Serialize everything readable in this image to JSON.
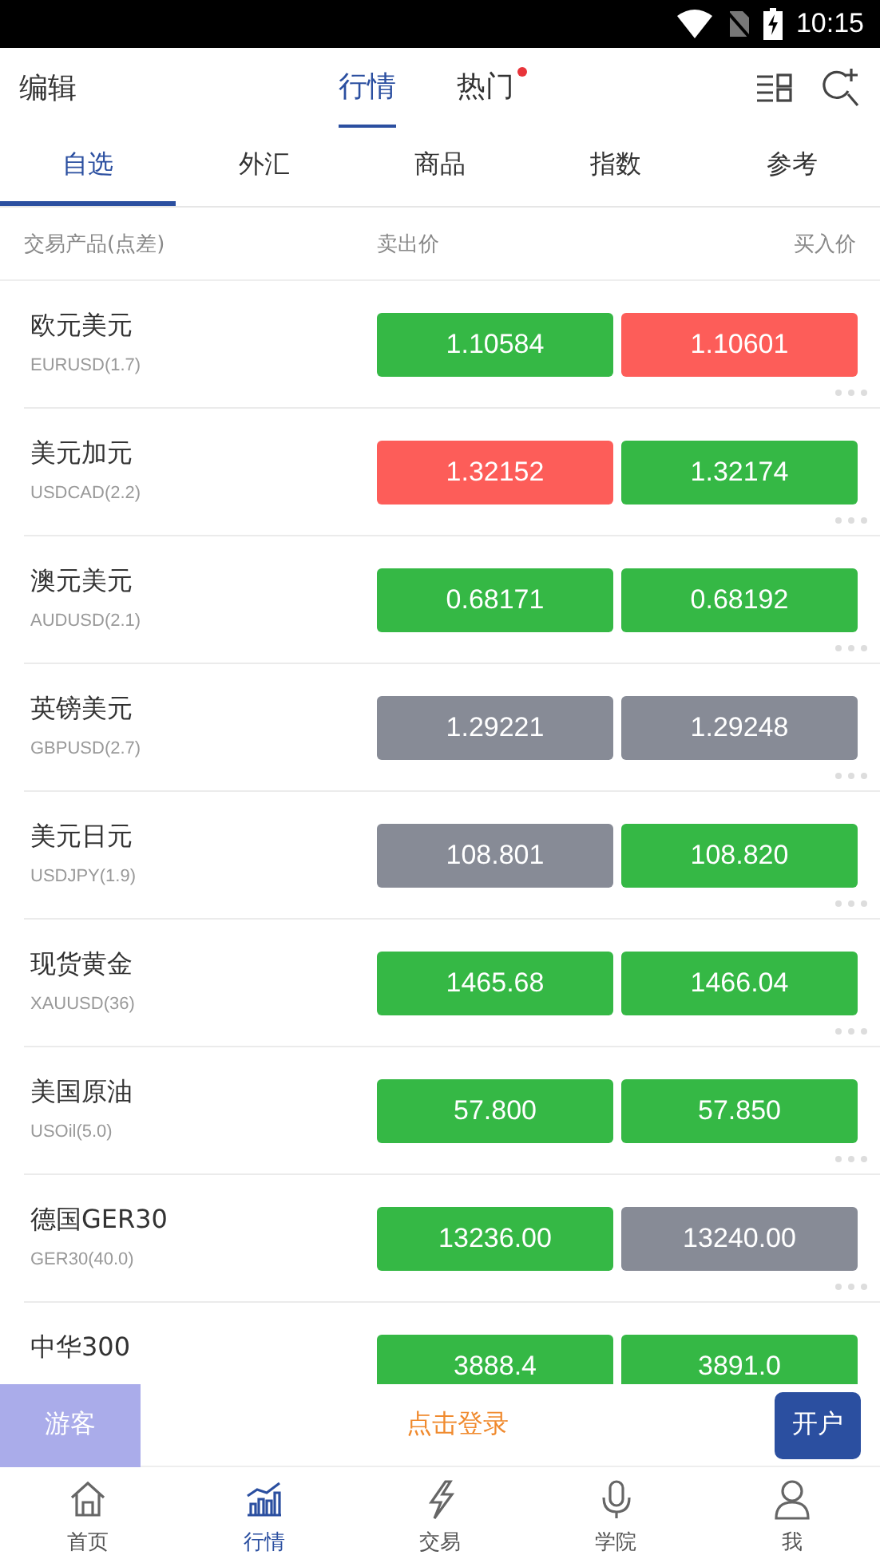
{
  "status_bar": {
    "time": "10:15"
  },
  "header": {
    "edit": "编辑",
    "tabs": [
      {
        "label": "行情",
        "selected": true,
        "dot": false
      },
      {
        "label": "热门",
        "selected": false,
        "dot": true
      }
    ]
  },
  "categories": [
    {
      "label": "自选",
      "selected": true
    },
    {
      "label": "外汇",
      "selected": false
    },
    {
      "label": "商品",
      "selected": false
    },
    {
      "label": "指数",
      "selected": false
    },
    {
      "label": "参考",
      "selected": false
    }
  ],
  "columns": [
    "交易产品(点差)",
    "卖出价",
    "买入价"
  ],
  "rows": [
    {
      "name": "欧元美元",
      "code": "EURUSD(1.7)",
      "sell": {
        "price": "1.10584",
        "color": "#35b845"
      },
      "buy": {
        "price": "1.10601",
        "color": "#fd5d59"
      }
    },
    {
      "name": "美元加元",
      "code": "USDCAD(2.2)",
      "sell": {
        "price": "1.32152",
        "color": "#fd5d59"
      },
      "buy": {
        "price": "1.32174",
        "color": "#35b845"
      }
    },
    {
      "name": "澳元美元",
      "code": "AUDUSD(2.1)",
      "sell": {
        "price": "0.68171",
        "color": "#35b845"
      },
      "buy": {
        "price": "0.68192",
        "color": "#35b845"
      }
    },
    {
      "name": "英镑美元",
      "code": "GBPUSD(2.7)",
      "sell": {
        "price": "1.29221",
        "color": "#878b96"
      },
      "buy": {
        "price": "1.29248",
        "color": "#878b96"
      }
    },
    {
      "name": "美元日元",
      "code": "USDJPY(1.9)",
      "sell": {
        "price": "108.801",
        "color": "#878b96"
      },
      "buy": {
        "price": "108.820",
        "color": "#35b845"
      }
    },
    {
      "name": "现货黄金",
      "code": "XAUUSD(36)",
      "sell": {
        "price": "1465.68",
        "color": "#35b845"
      },
      "buy": {
        "price": "1466.04",
        "color": "#35b845"
      }
    },
    {
      "name": "美国原油",
      "code": "USOil(5.0)",
      "sell": {
        "price": "57.800",
        "color": "#35b845"
      },
      "buy": {
        "price": "57.850",
        "color": "#35b845"
      }
    },
    {
      "name": "德国GER30",
      "code": "GER30(40.0)",
      "sell": {
        "price": "13236.00",
        "color": "#35b845"
      },
      "buy": {
        "price": "13240.00",
        "color": "#878b96"
      }
    },
    {
      "name": "中华300",
      "sell": {
        "price": "3888.4",
        "color": "#35b845"
      },
      "buy": {
        "price": "3891.0",
        "color": "#35b845"
      }
    }
  ],
  "login_bar": {
    "guest": "游客",
    "login": "点击登录",
    "open_account": "开户"
  },
  "bottom_nav": [
    {
      "label": "首页",
      "selected": false
    },
    {
      "label": "行情",
      "selected": true
    },
    {
      "label": "交易",
      "selected": false
    },
    {
      "label": "学院",
      "selected": false
    },
    {
      "label": "我",
      "selected": false
    }
  ]
}
